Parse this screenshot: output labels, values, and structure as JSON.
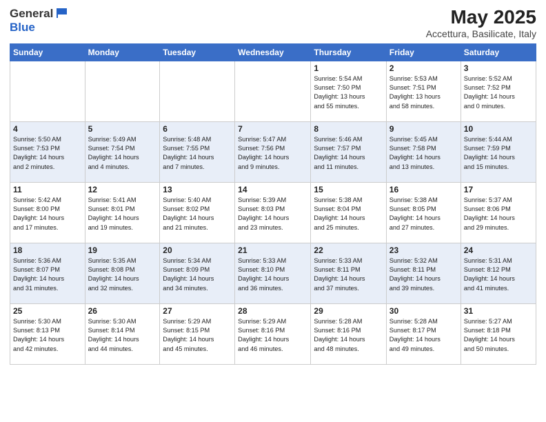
{
  "logo": {
    "general": "General",
    "blue": "Blue"
  },
  "title": "May 2025",
  "subtitle": "Accettura, Basilicate, Italy",
  "header_days": [
    "Sunday",
    "Monday",
    "Tuesday",
    "Wednesday",
    "Thursday",
    "Friday",
    "Saturday"
  ],
  "weeks": [
    [
      {
        "day": "",
        "info": ""
      },
      {
        "day": "",
        "info": ""
      },
      {
        "day": "",
        "info": ""
      },
      {
        "day": "",
        "info": ""
      },
      {
        "day": "1",
        "info": "Sunrise: 5:54 AM\nSunset: 7:50 PM\nDaylight: 13 hours\nand 55 minutes."
      },
      {
        "day": "2",
        "info": "Sunrise: 5:53 AM\nSunset: 7:51 PM\nDaylight: 13 hours\nand 58 minutes."
      },
      {
        "day": "3",
        "info": "Sunrise: 5:52 AM\nSunset: 7:52 PM\nDaylight: 14 hours\nand 0 minutes."
      }
    ],
    [
      {
        "day": "4",
        "info": "Sunrise: 5:50 AM\nSunset: 7:53 PM\nDaylight: 14 hours\nand 2 minutes."
      },
      {
        "day": "5",
        "info": "Sunrise: 5:49 AM\nSunset: 7:54 PM\nDaylight: 14 hours\nand 4 minutes."
      },
      {
        "day": "6",
        "info": "Sunrise: 5:48 AM\nSunset: 7:55 PM\nDaylight: 14 hours\nand 7 minutes."
      },
      {
        "day": "7",
        "info": "Sunrise: 5:47 AM\nSunset: 7:56 PM\nDaylight: 14 hours\nand 9 minutes."
      },
      {
        "day": "8",
        "info": "Sunrise: 5:46 AM\nSunset: 7:57 PM\nDaylight: 14 hours\nand 11 minutes."
      },
      {
        "day": "9",
        "info": "Sunrise: 5:45 AM\nSunset: 7:58 PM\nDaylight: 14 hours\nand 13 minutes."
      },
      {
        "day": "10",
        "info": "Sunrise: 5:44 AM\nSunset: 7:59 PM\nDaylight: 14 hours\nand 15 minutes."
      }
    ],
    [
      {
        "day": "11",
        "info": "Sunrise: 5:42 AM\nSunset: 8:00 PM\nDaylight: 14 hours\nand 17 minutes."
      },
      {
        "day": "12",
        "info": "Sunrise: 5:41 AM\nSunset: 8:01 PM\nDaylight: 14 hours\nand 19 minutes."
      },
      {
        "day": "13",
        "info": "Sunrise: 5:40 AM\nSunset: 8:02 PM\nDaylight: 14 hours\nand 21 minutes."
      },
      {
        "day": "14",
        "info": "Sunrise: 5:39 AM\nSunset: 8:03 PM\nDaylight: 14 hours\nand 23 minutes."
      },
      {
        "day": "15",
        "info": "Sunrise: 5:38 AM\nSunset: 8:04 PM\nDaylight: 14 hours\nand 25 minutes."
      },
      {
        "day": "16",
        "info": "Sunrise: 5:38 AM\nSunset: 8:05 PM\nDaylight: 14 hours\nand 27 minutes."
      },
      {
        "day": "17",
        "info": "Sunrise: 5:37 AM\nSunset: 8:06 PM\nDaylight: 14 hours\nand 29 minutes."
      }
    ],
    [
      {
        "day": "18",
        "info": "Sunrise: 5:36 AM\nSunset: 8:07 PM\nDaylight: 14 hours\nand 31 minutes."
      },
      {
        "day": "19",
        "info": "Sunrise: 5:35 AM\nSunset: 8:08 PM\nDaylight: 14 hours\nand 32 minutes."
      },
      {
        "day": "20",
        "info": "Sunrise: 5:34 AM\nSunset: 8:09 PM\nDaylight: 14 hours\nand 34 minutes."
      },
      {
        "day": "21",
        "info": "Sunrise: 5:33 AM\nSunset: 8:10 PM\nDaylight: 14 hours\nand 36 minutes."
      },
      {
        "day": "22",
        "info": "Sunrise: 5:33 AM\nSunset: 8:11 PM\nDaylight: 14 hours\nand 37 minutes."
      },
      {
        "day": "23",
        "info": "Sunrise: 5:32 AM\nSunset: 8:11 PM\nDaylight: 14 hours\nand 39 minutes."
      },
      {
        "day": "24",
        "info": "Sunrise: 5:31 AM\nSunset: 8:12 PM\nDaylight: 14 hours\nand 41 minutes."
      }
    ],
    [
      {
        "day": "25",
        "info": "Sunrise: 5:30 AM\nSunset: 8:13 PM\nDaylight: 14 hours\nand 42 minutes."
      },
      {
        "day": "26",
        "info": "Sunrise: 5:30 AM\nSunset: 8:14 PM\nDaylight: 14 hours\nand 44 minutes."
      },
      {
        "day": "27",
        "info": "Sunrise: 5:29 AM\nSunset: 8:15 PM\nDaylight: 14 hours\nand 45 minutes."
      },
      {
        "day": "28",
        "info": "Sunrise: 5:29 AM\nSunset: 8:16 PM\nDaylight: 14 hours\nand 46 minutes."
      },
      {
        "day": "29",
        "info": "Sunrise: 5:28 AM\nSunset: 8:16 PM\nDaylight: 14 hours\nand 48 minutes."
      },
      {
        "day": "30",
        "info": "Sunrise: 5:28 AM\nSunset: 8:17 PM\nDaylight: 14 hours\nand 49 minutes."
      },
      {
        "day": "31",
        "info": "Sunrise: 5:27 AM\nSunset: 8:18 PM\nDaylight: 14 hours\nand 50 minutes."
      }
    ]
  ]
}
